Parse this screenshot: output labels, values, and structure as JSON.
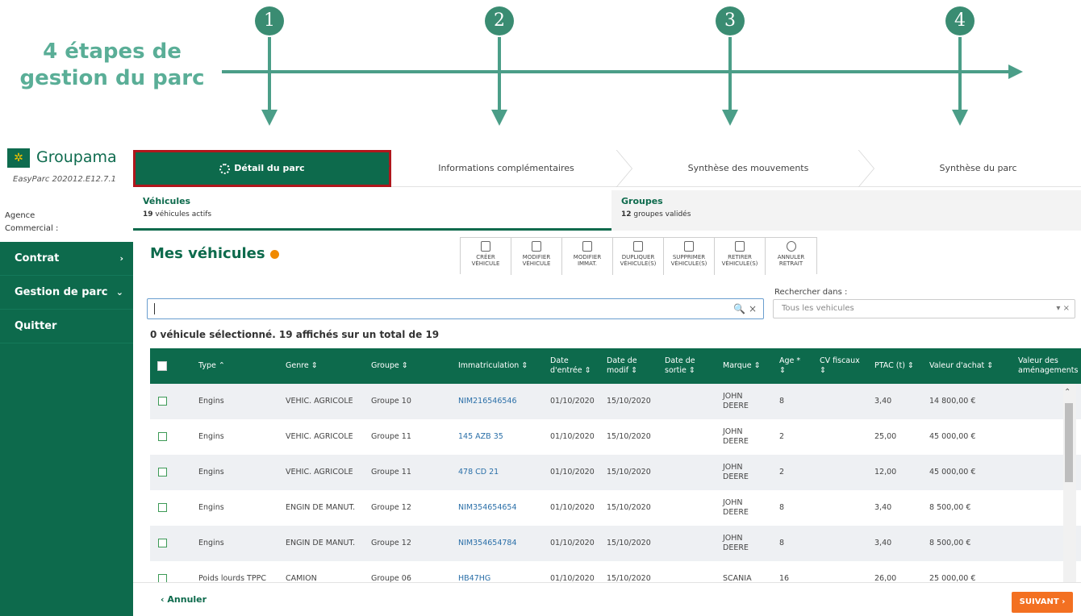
{
  "annotation": {
    "title": "4 étapes de gestion du parc",
    "steps": [
      "1",
      "2",
      "3",
      "4"
    ]
  },
  "brand": {
    "name": "Groupama",
    "version": "EasyParc 202012.E12.7.1",
    "colors": {
      "primary": "#0d6a4c",
      "accent": "#f37021",
      "highlight": "#b0161c"
    }
  },
  "user": {
    "agence_label": "Agence",
    "commercial_label": "Commercial :"
  },
  "sidebar": {
    "items": [
      {
        "label": "Contrat",
        "chevron": "›"
      },
      {
        "label": "Gestion de parc",
        "chevron": "⌄"
      },
      {
        "label": "Quitter",
        "chevron": ""
      }
    ]
  },
  "stepper": {
    "steps": [
      {
        "label": "Détail du parc",
        "active": true
      },
      {
        "label": "Informations complémentaires",
        "active": false
      },
      {
        "label": "Synthèse des mouvements",
        "active": false
      },
      {
        "label": "Synthèse du parc",
        "active": false
      }
    ]
  },
  "tabs": [
    {
      "title": "Véhicules",
      "count": "19",
      "sub": " véhicules actifs"
    },
    {
      "title": "Groupes",
      "count": "12",
      "sub": " groupes validés"
    }
  ],
  "main": {
    "title": "Mes véhicules",
    "toolbar": [
      {
        "label": "CRÉER\nVÉHICULE",
        "icon": "file-icon"
      },
      {
        "label": "MODIFIER\nVÉHICULE",
        "icon": "pencil-icon"
      },
      {
        "label": "MODIFIER\nIMMAT.",
        "icon": "plate-icon"
      },
      {
        "label": "DUPLIQUER\nVÉHICULE(S)",
        "icon": "copy-icon"
      },
      {
        "label": "SUPPRIMER\nVÉHICULE(S)",
        "icon": "trash-icon"
      },
      {
        "label": "RETIRER\nVÉHICULE(S)",
        "icon": "car-remove-icon"
      },
      {
        "label": "ANNULER\nRETRAIT",
        "icon": "undo-icon"
      }
    ],
    "search": {
      "value": "",
      "icons": "🔍 ×",
      "scope_label": "Rechercher dans :",
      "scope_value": "Tous les vehicules"
    },
    "selection_summary": "0 véhicule sélectionné. 19 affichés sur un total de 19"
  },
  "table": {
    "columns": [
      "Type ⌃",
      "Genre ⇕",
      "Groupe ⇕",
      "Immatriculation ⇕",
      "Date\nd'entrée ⇕",
      "Date de\nmodif ⇕",
      "Date de\nsortie ⇕",
      "Marque ⇕",
      "Age *\n⇕",
      "CV fiscaux\n⇕",
      "PTAC (t) ⇕",
      "Valeur d'achat ⇕",
      "Valeur des\naménagements"
    ],
    "rows": [
      [
        "Engins",
        "VEHIC. AGRICOLE",
        "Groupe 10",
        "NIM216546546",
        "01/10/2020",
        "15/10/2020",
        "",
        "JOHN\nDEERE",
        "8",
        "",
        "3,40",
        "14 800,00 €",
        ""
      ],
      [
        "Engins",
        "VEHIC. AGRICOLE",
        "Groupe 11",
        "145 AZB 35",
        "01/10/2020",
        "15/10/2020",
        "",
        "JOHN\nDEERE",
        "2",
        "",
        "25,00",
        "45 000,00 €",
        ""
      ],
      [
        "Engins",
        "VEHIC. AGRICOLE",
        "Groupe 11",
        "478 CD 21",
        "01/10/2020",
        "15/10/2020",
        "",
        "JOHN\nDEERE",
        "2",
        "",
        "12,00",
        "45 000,00 €",
        ""
      ],
      [
        "Engins",
        "ENGIN DE MANUT.",
        "Groupe 12",
        "NIM354654654",
        "01/10/2020",
        "15/10/2020",
        "",
        "JOHN\nDEERE",
        "8",
        "",
        "3,40",
        "8 500,00 €",
        ""
      ],
      [
        "Engins",
        "ENGIN DE MANUT.",
        "Groupe 12",
        "NIM354654784",
        "01/10/2020",
        "15/10/2020",
        "",
        "JOHN\nDEERE",
        "8",
        "",
        "3,40",
        "8 500,00 €",
        ""
      ],
      [
        "Poids lourds TPPC",
        "CAMION",
        "Groupe 06",
        "HB47HG",
        "01/10/2020",
        "15/10/2020",
        "",
        "SCANIA",
        "16",
        "",
        "26,00",
        "25 000,00 €",
        ""
      ]
    ]
  },
  "footer": {
    "cancel_label": "Annuler",
    "cancel_icon": "‹",
    "next_label": "SUIVANT",
    "next_icon": "›"
  }
}
